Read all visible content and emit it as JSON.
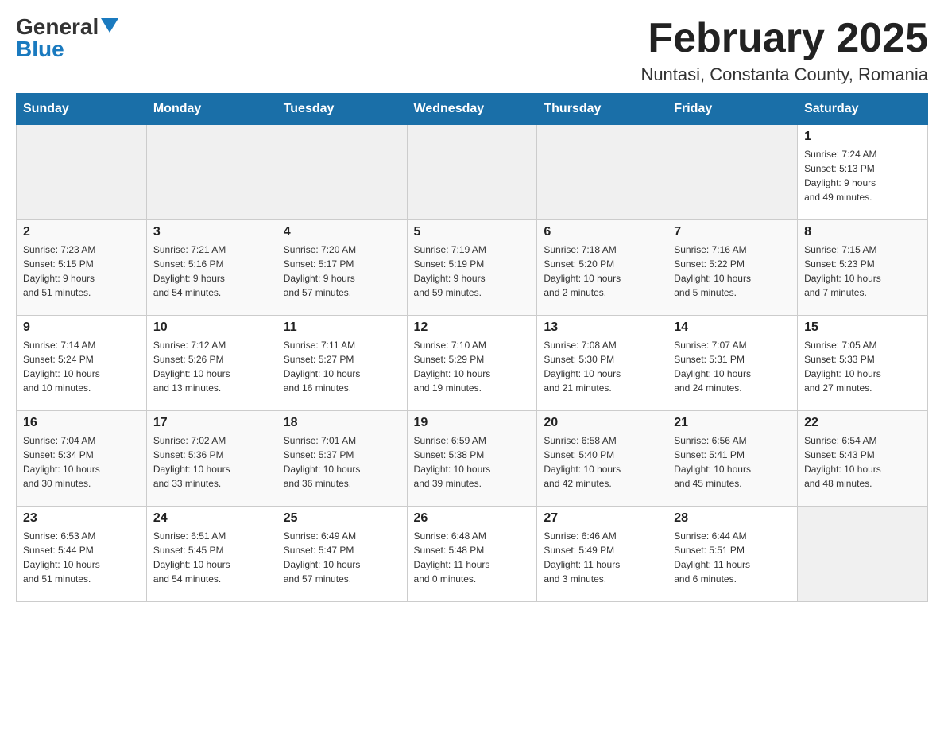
{
  "header": {
    "logo_general": "General",
    "logo_blue": "Blue",
    "month": "February 2025",
    "location": "Nuntasi, Constanta County, Romania"
  },
  "days_of_week": [
    "Sunday",
    "Monday",
    "Tuesday",
    "Wednesday",
    "Thursday",
    "Friday",
    "Saturday"
  ],
  "weeks": [
    [
      {
        "day": "",
        "info": ""
      },
      {
        "day": "",
        "info": ""
      },
      {
        "day": "",
        "info": ""
      },
      {
        "day": "",
        "info": ""
      },
      {
        "day": "",
        "info": ""
      },
      {
        "day": "",
        "info": ""
      },
      {
        "day": "1",
        "info": "Sunrise: 7:24 AM\nSunset: 5:13 PM\nDaylight: 9 hours\nand 49 minutes."
      }
    ],
    [
      {
        "day": "2",
        "info": "Sunrise: 7:23 AM\nSunset: 5:15 PM\nDaylight: 9 hours\nand 51 minutes."
      },
      {
        "day": "3",
        "info": "Sunrise: 7:21 AM\nSunset: 5:16 PM\nDaylight: 9 hours\nand 54 minutes."
      },
      {
        "day": "4",
        "info": "Sunrise: 7:20 AM\nSunset: 5:17 PM\nDaylight: 9 hours\nand 57 minutes."
      },
      {
        "day": "5",
        "info": "Sunrise: 7:19 AM\nSunset: 5:19 PM\nDaylight: 9 hours\nand 59 minutes."
      },
      {
        "day": "6",
        "info": "Sunrise: 7:18 AM\nSunset: 5:20 PM\nDaylight: 10 hours\nand 2 minutes."
      },
      {
        "day": "7",
        "info": "Sunrise: 7:16 AM\nSunset: 5:22 PM\nDaylight: 10 hours\nand 5 minutes."
      },
      {
        "day": "8",
        "info": "Sunrise: 7:15 AM\nSunset: 5:23 PM\nDaylight: 10 hours\nand 7 minutes."
      }
    ],
    [
      {
        "day": "9",
        "info": "Sunrise: 7:14 AM\nSunset: 5:24 PM\nDaylight: 10 hours\nand 10 minutes."
      },
      {
        "day": "10",
        "info": "Sunrise: 7:12 AM\nSunset: 5:26 PM\nDaylight: 10 hours\nand 13 minutes."
      },
      {
        "day": "11",
        "info": "Sunrise: 7:11 AM\nSunset: 5:27 PM\nDaylight: 10 hours\nand 16 minutes."
      },
      {
        "day": "12",
        "info": "Sunrise: 7:10 AM\nSunset: 5:29 PM\nDaylight: 10 hours\nand 19 minutes."
      },
      {
        "day": "13",
        "info": "Sunrise: 7:08 AM\nSunset: 5:30 PM\nDaylight: 10 hours\nand 21 minutes."
      },
      {
        "day": "14",
        "info": "Sunrise: 7:07 AM\nSunset: 5:31 PM\nDaylight: 10 hours\nand 24 minutes."
      },
      {
        "day": "15",
        "info": "Sunrise: 7:05 AM\nSunset: 5:33 PM\nDaylight: 10 hours\nand 27 minutes."
      }
    ],
    [
      {
        "day": "16",
        "info": "Sunrise: 7:04 AM\nSunset: 5:34 PM\nDaylight: 10 hours\nand 30 minutes."
      },
      {
        "day": "17",
        "info": "Sunrise: 7:02 AM\nSunset: 5:36 PM\nDaylight: 10 hours\nand 33 minutes."
      },
      {
        "day": "18",
        "info": "Sunrise: 7:01 AM\nSunset: 5:37 PM\nDaylight: 10 hours\nand 36 minutes."
      },
      {
        "day": "19",
        "info": "Sunrise: 6:59 AM\nSunset: 5:38 PM\nDaylight: 10 hours\nand 39 minutes."
      },
      {
        "day": "20",
        "info": "Sunrise: 6:58 AM\nSunset: 5:40 PM\nDaylight: 10 hours\nand 42 minutes."
      },
      {
        "day": "21",
        "info": "Sunrise: 6:56 AM\nSunset: 5:41 PM\nDaylight: 10 hours\nand 45 minutes."
      },
      {
        "day": "22",
        "info": "Sunrise: 6:54 AM\nSunset: 5:43 PM\nDaylight: 10 hours\nand 48 minutes."
      }
    ],
    [
      {
        "day": "23",
        "info": "Sunrise: 6:53 AM\nSunset: 5:44 PM\nDaylight: 10 hours\nand 51 minutes."
      },
      {
        "day": "24",
        "info": "Sunrise: 6:51 AM\nSunset: 5:45 PM\nDaylight: 10 hours\nand 54 minutes."
      },
      {
        "day": "25",
        "info": "Sunrise: 6:49 AM\nSunset: 5:47 PM\nDaylight: 10 hours\nand 57 minutes."
      },
      {
        "day": "26",
        "info": "Sunrise: 6:48 AM\nSunset: 5:48 PM\nDaylight: 11 hours\nand 0 minutes."
      },
      {
        "day": "27",
        "info": "Sunrise: 6:46 AM\nSunset: 5:49 PM\nDaylight: 11 hours\nand 3 minutes."
      },
      {
        "day": "28",
        "info": "Sunrise: 6:44 AM\nSunset: 5:51 PM\nDaylight: 11 hours\nand 6 minutes."
      },
      {
        "day": "",
        "info": ""
      }
    ]
  ]
}
